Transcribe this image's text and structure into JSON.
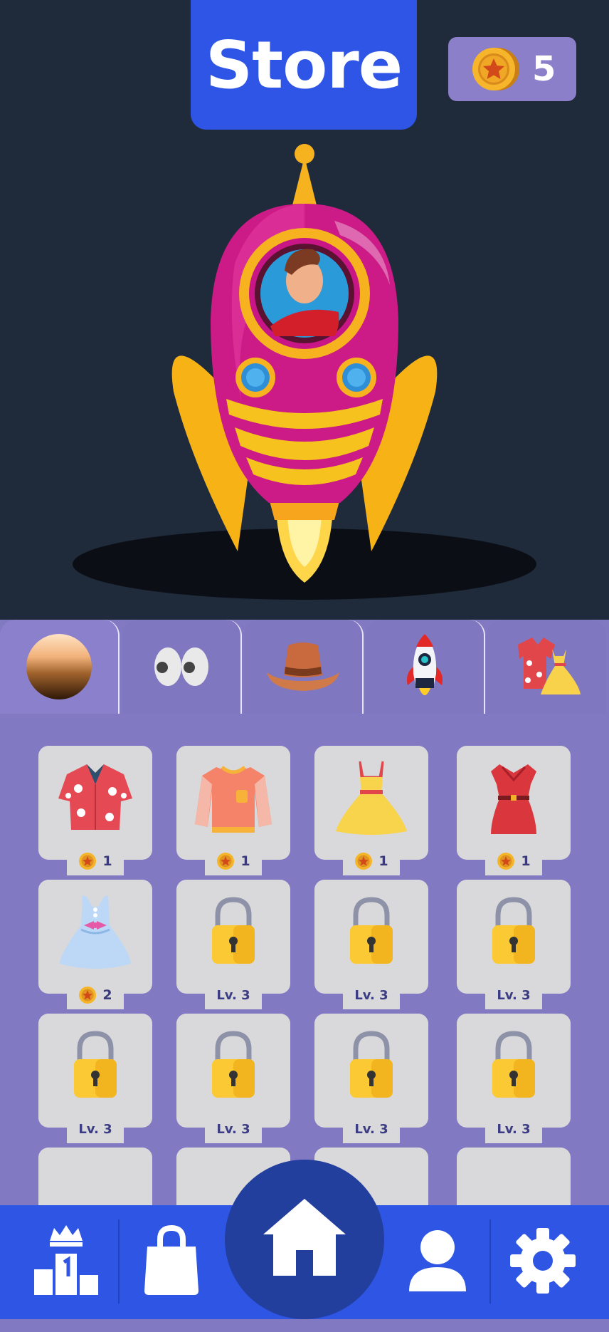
{
  "header": {
    "title": "Store",
    "coin_balance": "5"
  },
  "tabs": [
    {
      "name": "skin-tone",
      "icon": "skin-gradient-icon",
      "active": true
    },
    {
      "name": "eyes",
      "icon": "eyes-icon"
    },
    {
      "name": "hats",
      "icon": "hat-icon"
    },
    {
      "name": "rockets",
      "icon": "rocket-icon"
    },
    {
      "name": "outfits",
      "icon": "outfits-icon"
    }
  ],
  "items": [
    {
      "icon": "hawaiian-shirt-icon",
      "price": "1",
      "locked": false
    },
    {
      "icon": "sweater-icon",
      "price": "1",
      "locked": false
    },
    {
      "icon": "yellow-dress-icon",
      "price": "1",
      "locked": false
    },
    {
      "icon": "red-dress-icon",
      "price": "1",
      "locked": false
    },
    {
      "icon": "blue-dress-icon",
      "price": "2",
      "locked": false
    },
    {
      "icon": "lock-icon",
      "level": "Lv. 3",
      "locked": true
    },
    {
      "icon": "lock-icon",
      "level": "Lv. 3",
      "locked": true
    },
    {
      "icon": "lock-icon",
      "level": "Lv. 3",
      "locked": true
    },
    {
      "icon": "lock-icon",
      "level": "Lv. 3",
      "locked": true
    },
    {
      "icon": "lock-icon",
      "level": "Lv. 3",
      "locked": true
    },
    {
      "icon": "lock-icon",
      "level": "Lv. 3",
      "locked": true
    },
    {
      "icon": "lock-icon",
      "level": "Lv. 3",
      "locked": true
    }
  ],
  "nav": [
    {
      "name": "leaderboard",
      "icon": "podium-crown-icon"
    },
    {
      "name": "store",
      "icon": "shopping-bag-icon"
    },
    {
      "name": "home",
      "icon": "home-icon"
    },
    {
      "name": "profile",
      "icon": "user-icon"
    },
    {
      "name": "settings",
      "icon": "gear-icon"
    }
  ],
  "colors": {
    "background": "#1f2a3a",
    "accent_blue": "#2f55e6",
    "panel_purple": "#8279c3",
    "coin_gold": "#f5b52a"
  }
}
